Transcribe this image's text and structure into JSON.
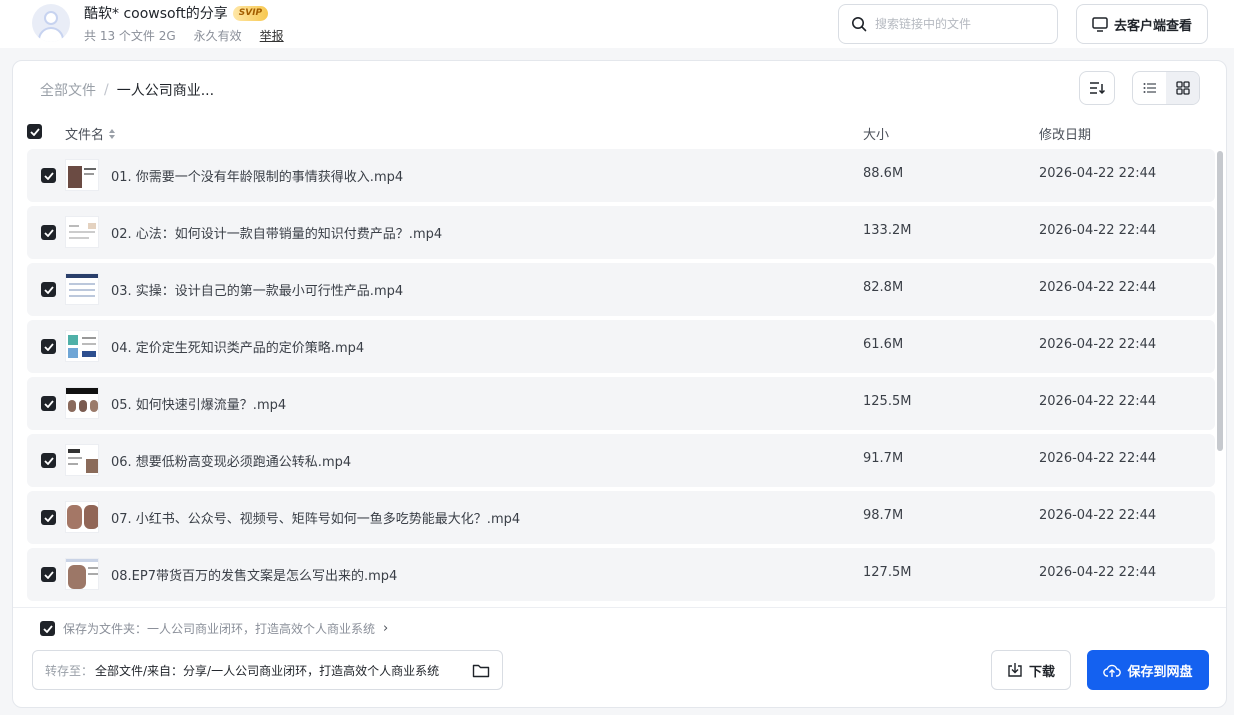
{
  "header": {
    "title": "酷软* coowsoft的分享",
    "vip_badge": "SVIP",
    "file_count": "共 13 个文件 2G",
    "validity": "永久有效",
    "report": "举报",
    "search_placeholder": "搜索链接中的文件",
    "client_button": "去客户端查看"
  },
  "breadcrumb": {
    "root": "全部文件",
    "separator": "/",
    "current": "一人公司商业..."
  },
  "table": {
    "columns": {
      "name": "文件名",
      "size": "大小",
      "date": "修改日期"
    },
    "rows": [
      {
        "name": "01. 你需要一个没有年龄限制的事情获得收入.mp4",
        "size": "88.6M",
        "date": "2026-04-22 22:44"
      },
      {
        "name": "02. 心法：如何设计一款自带销量的知识付费产品？.mp4",
        "size": "133.2M",
        "date": "2026-04-22 22:44"
      },
      {
        "name": "03. 实操：设计自己的第一款最小可行性产品.mp4",
        "size": "82.8M",
        "date": "2026-04-22 22:44"
      },
      {
        "name": "04. 定价定生死知识类产品的定价策略.mp4",
        "size": "61.6M",
        "date": "2026-04-22 22:44"
      },
      {
        "name": "05. 如何快速引爆流量？.mp4",
        "size": "125.5M",
        "date": "2026-04-22 22:44"
      },
      {
        "name": "06. 想要低粉高变现必须跑通公转私.mp4",
        "size": "91.7M",
        "date": "2026-04-22 22:44"
      },
      {
        "name": "07. 小红书、公众号、视频号、矩阵号如何一鱼多吃势能最大化？.mp4",
        "size": "98.7M",
        "date": "2026-04-22 22:44"
      },
      {
        "name": "08.EP7带货百万的发售文案是怎么写出来的.mp4",
        "size": "127.5M",
        "date": "2026-04-22 22:44"
      }
    ]
  },
  "footer": {
    "save_as_folder": "保存为文件夹：一人公司商业闭环，打造高效个人商业系统",
    "dest_label": "转存至：",
    "dest_path": "全部文件/来自：分享/一人公司商业闭环，打造高效个人商业系统",
    "download": "下载",
    "save": "保存到网盘"
  },
  "colors": {
    "primary": "#1461f0",
    "row_bg": "#f4f5f7",
    "checkbox": "#1f2329"
  }
}
